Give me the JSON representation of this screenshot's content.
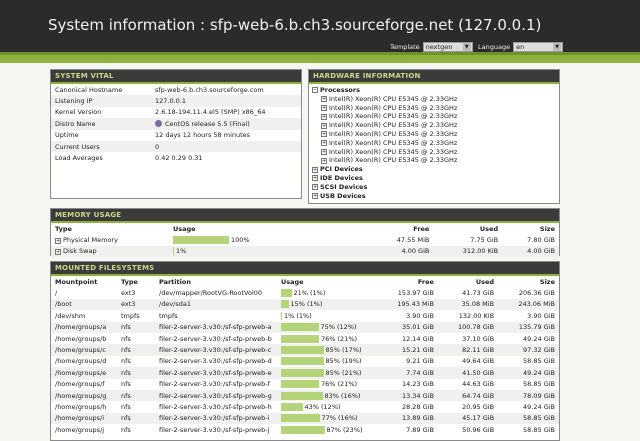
{
  "header": {
    "title": "System information : sfp-web-6.b.ch3.sourceforge.net (127.0.0.1)",
    "template_label": "Template",
    "template_value": "nextgen",
    "language_label": "Language",
    "language_value": "en"
  },
  "vital": {
    "title": "SYSTEM VITAL",
    "rows": [
      {
        "k": "Canonical Hostname",
        "v": "sfp-web-6.b.ch3.sourceforge.com"
      },
      {
        "k": "Listening IP",
        "v": "127.0.0.1"
      },
      {
        "k": "Kernel Version",
        "v": "2.6.18-194.11.4.el5 (SMP) x86_64"
      },
      {
        "k": "Distro Name",
        "v": "CentOS release 5.5 (Final)"
      },
      {
        "k": "Uptime",
        "v": "12 days 12 hours 58 minutes"
      },
      {
        "k": "Current Users",
        "v": "0"
      },
      {
        "k": "Load Averages",
        "v": "0.42 0.29 0.31"
      }
    ]
  },
  "hardware": {
    "title": "HARDWARE INFORMATION",
    "processors_label": "Processors",
    "cpus": [
      "Intel(R) Xeon(R) CPU E5345 @ 2.33GHz",
      "Intel(R) Xeon(R) CPU E5345 @ 2.33GHz",
      "Intel(R) Xeon(R) CPU E5345 @ 2.33GHz",
      "Intel(R) Xeon(R) CPU E5345 @ 2.33GHz",
      "Intel(R) Xeon(R) CPU E5345 @ 2.33GHz",
      "Intel(R) Xeon(R) CPU E5345 @ 2.33GHz",
      "Intel(R) Xeon(R) CPU E5345 @ 2.33GHz",
      "Intel(R) Xeon(R) CPU E5345 @ 2.33GHz"
    ],
    "groups": [
      "PCI Devices",
      "IDE Devices",
      "SCSI Devices",
      "USB Devices"
    ]
  },
  "memory": {
    "title": "MEMORY USAGE",
    "headers": {
      "type": "Type",
      "usage": "Usage",
      "free": "Free",
      "used": "Used",
      "size": "Size"
    },
    "rows": [
      {
        "type": "Physical Memory",
        "percent": 100,
        "label": "100%",
        "free": "47.55 MiB",
        "used": "7.75 GiB",
        "size": "7.80 GiB"
      },
      {
        "type": "Disk Swap",
        "percent": 1,
        "label": "1%",
        "free": "4.00 GiB",
        "used": "312.00 KiB",
        "size": "4.00 GiB"
      }
    ]
  },
  "filesystems": {
    "title": "MOUNTED FILESYSTEMS",
    "headers": {
      "mount": "Mountpoint",
      "type": "Type",
      "partition": "Partition",
      "usage": "Usage",
      "free": "Free",
      "used": "Used",
      "size": "Size"
    },
    "rows": [
      {
        "mount": "/",
        "type": "ext3",
        "partition": "/dev/mapper/RootVG-RootVol00",
        "percent": 21,
        "label": "21% (1%)",
        "free": "153.97 GiB",
        "used": "41.73 GiB",
        "size": "206.36 GiB"
      },
      {
        "mount": "/boot",
        "type": "ext3",
        "partition": "/dev/sda1",
        "percent": 15,
        "label": "15% (1%)",
        "free": "195.43 MiB",
        "used": "35.08 MiB",
        "size": "243.06 MiB"
      },
      {
        "mount": "/dev/shm",
        "type": "tmpfs",
        "partition": "tmpfs",
        "percent": 1,
        "label": "1% (1%)",
        "free": "3.90 GiB",
        "used": "132.00 KiB",
        "size": "3.90 GiB"
      },
      {
        "mount": "/home/groups/a",
        "type": "nfs",
        "partition": "filer-2-server-3.v30:/sf-sfp-prweb-a",
        "percent": 75,
        "label": "75% (12%)",
        "free": "35.01 GiB",
        "used": "100.78 GiB",
        "size": "135.79 GiB"
      },
      {
        "mount": "/home/groups/b",
        "type": "nfs",
        "partition": "filer-2-server-3.v30:/sf-sfp-prweb-b",
        "percent": 76,
        "label": "76% (21%)",
        "free": "12.14 GiB",
        "used": "37.10 GiB",
        "size": "49.24 GiB"
      },
      {
        "mount": "/home/groups/c",
        "type": "nfs",
        "partition": "filer-2-server-3.v30:/sf-sfp-prweb-c",
        "percent": 85,
        "label": "85% (17%)",
        "free": "15.21 GiB",
        "used": "82.11 GiB",
        "size": "97.32 GiB"
      },
      {
        "mount": "/home/groups/d",
        "type": "nfs",
        "partition": "filer-2-server-3.v30:/sf-sfp-prweb-d",
        "percent": 85,
        "label": "85% (19%)",
        "free": "9.21 GiB",
        "used": "49.64 GiB",
        "size": "58.85 GiB"
      },
      {
        "mount": "/home/groups/e",
        "type": "nfs",
        "partition": "filer-2-server-3.v30:/sf-sfp-prweb-e",
        "percent": 85,
        "label": "85% (21%)",
        "free": "7.74 GiB",
        "used": "41.50 GiB",
        "size": "49.24 GiB"
      },
      {
        "mount": "/home/groups/f",
        "type": "nfs",
        "partition": "filer-2-server-3.v30:/sf-sfp-prweb-f",
        "percent": 76,
        "label": "76% (21%)",
        "free": "14.23 GiB",
        "used": "44.63 GiB",
        "size": "58.85 GiB"
      },
      {
        "mount": "/home/groups/g",
        "type": "nfs",
        "partition": "filer-2-server-3.v30:/sf-sfp-prweb-g",
        "percent": 83,
        "label": "83% (16%)",
        "free": "13.34 GiB",
        "used": "64.74 GiB",
        "size": "78.09 GiB"
      },
      {
        "mount": "/home/groups/h",
        "type": "nfs",
        "partition": "filer-2-server-3.v30:/sf-sfp-prweb-h",
        "percent": 43,
        "label": "43% (12%)",
        "free": "28.28 GiB",
        "used": "20.95 GiB",
        "size": "49.24 GiB"
      },
      {
        "mount": "/home/groups/i",
        "type": "nfs",
        "partition": "filer-2-server-3.v30:/sf-sfp-prweb-i",
        "percent": 77,
        "label": "77% (16%)",
        "free": "13.89 GiB",
        "used": "45.17 GiB",
        "size": "58.85 GiB"
      },
      {
        "mount": "/home/groups/j",
        "type": "nfs",
        "partition": "filer-2-server-3.v30:/sf-sfp-prweb-j",
        "percent": 87,
        "label": "87% (23%)",
        "free": "7.89 GiB",
        "used": "50.96 GiB",
        "size": "58.85 GiB"
      }
    ]
  }
}
